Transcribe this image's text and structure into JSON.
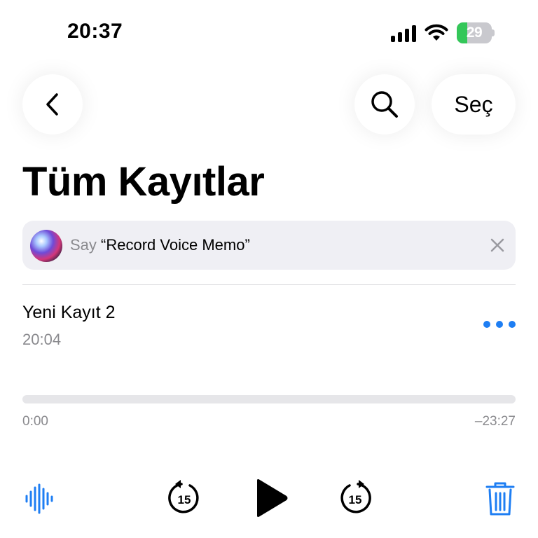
{
  "status_bar": {
    "time": "20:37",
    "battery_percent": 29,
    "battery_text": "29",
    "battery_color": "#34c759",
    "icons": [
      "cellular-signal-icon",
      "wifi-icon",
      "battery-charging-icon"
    ]
  },
  "nav": {
    "back_icon": "chevron-left-icon",
    "search_icon": "search-icon",
    "select_label": "Seç"
  },
  "page": {
    "title": "Tüm Kayıtlar"
  },
  "siri_suggestion": {
    "say": "Say",
    "phrase": "“Record Voice Memo”",
    "icon": "siri-icon",
    "close_icon": "close-icon"
  },
  "recording": {
    "title": "Yeni Kayıt 2",
    "time": "20:04",
    "more_icon": "ellipsis-icon",
    "accent_color": "#1e7ef3"
  },
  "playback": {
    "progress": 0,
    "elapsed": "0:00",
    "remaining": "–23:27"
  },
  "controls": {
    "waveform_icon": "waveform-icon",
    "skip_back_label": "15",
    "skip_forward_label": "15",
    "play_icon": "play-icon",
    "trash_icon": "trash-icon"
  }
}
